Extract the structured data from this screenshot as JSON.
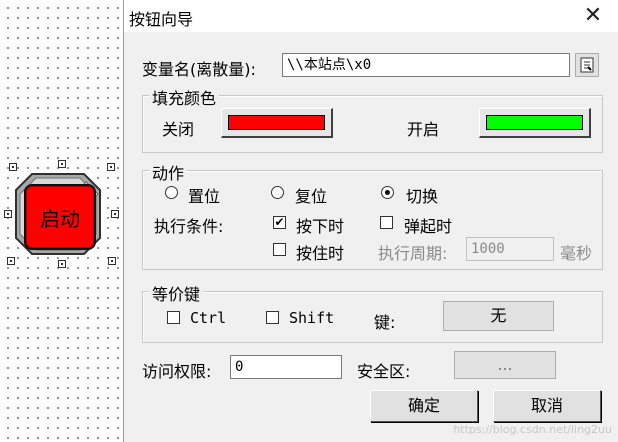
{
  "canvas": {
    "button_label": "启动"
  },
  "dialog": {
    "title": "按钮向导",
    "close_icon": "close-icon",
    "variable": {
      "label": "变量名(离散量):",
      "value": "\\\\本站点\\x0",
      "browse_icon": "variable-browse-icon"
    },
    "fill_color": {
      "title": "填充颜色",
      "off_label": "关闭",
      "off_color": "#ff0000",
      "on_label": "开启",
      "on_color": "#00ff00"
    },
    "action": {
      "title": "动作",
      "radios": [
        {
          "label": "置位",
          "checked": false
        },
        {
          "label": "复位",
          "checked": false
        },
        {
          "label": "切换",
          "checked": true
        }
      ],
      "condition_label": "执行条件:",
      "press_down": {
        "label": "按下时",
        "checked": true
      },
      "pop_up": {
        "label": "弹起时",
        "checked": false
      },
      "hold": {
        "label": "按住时",
        "checked": false
      },
      "period_label": "执行周期:",
      "period_value": "1000",
      "period_unit": "毫秒"
    },
    "hotkey": {
      "title": "等价键",
      "ctrl_label": "Ctrl",
      "ctrl_checked": false,
      "shift_label": "Shift",
      "shift_checked": false,
      "key_label": "键:",
      "key_value": "无"
    },
    "access": {
      "label": "访问权限:",
      "value": "0",
      "safe_zone_label": "安全区:",
      "safe_zone_button": "..."
    },
    "ok_label": "确定",
    "cancel_label": "取消",
    "watermark": "https://blog.csdn.net/ling2uu"
  }
}
